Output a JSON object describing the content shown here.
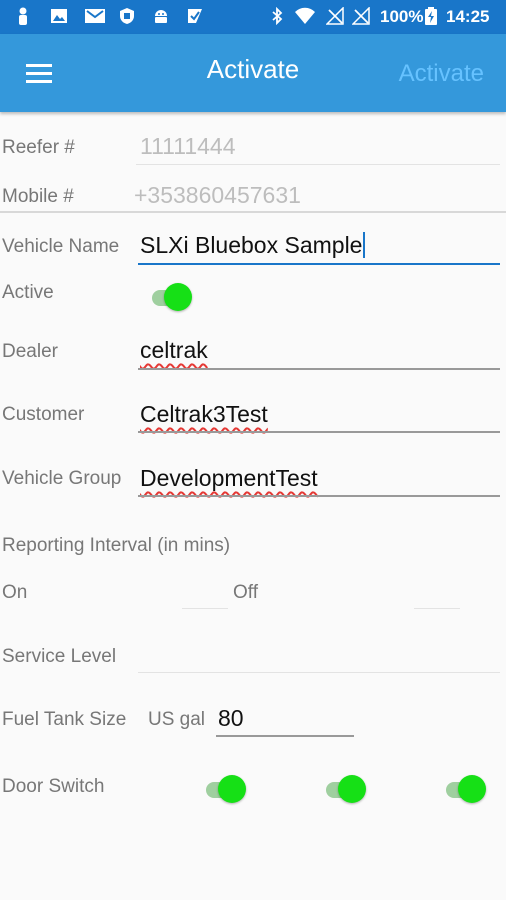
{
  "status_bar": {
    "battery_percent": "100%",
    "time": "14:25",
    "left_icons": [
      "person-icon",
      "image-icon",
      "gmail-icon",
      "shield-icon",
      "android-icon",
      "checkbox-icon"
    ],
    "right_icons": [
      "bluetooth-icon",
      "wifi-icon",
      "no-signal-icon",
      "no-signal-icon",
      "battery-icon"
    ]
  },
  "app_bar": {
    "title": "Activate",
    "action_label": "Activate",
    "menu_icon": "hamburger-menu-icon"
  },
  "form": {
    "reefer": {
      "label": "Reefer #",
      "value": "11111444"
    },
    "mobile": {
      "label": "Mobile #",
      "value": "+353860457631"
    },
    "vehicle_name": {
      "label": "Vehicle Name",
      "value": "SLXi Bluebox Sample"
    },
    "active": {
      "label": "Active",
      "on": true
    },
    "dealer": {
      "label": "Dealer",
      "value": "celtrak"
    },
    "customer": {
      "label": "Customer",
      "value": "Celtrak3Test"
    },
    "vehicle_group": {
      "label": "Vehicle Group",
      "value": "DevelopmentTest"
    },
    "reporting_interval": {
      "label": "Reporting Interval (in mins)",
      "on_label": "On",
      "off_label": "Off",
      "on_value": "",
      "off_value": ""
    },
    "service_level": {
      "label": "Service Level",
      "value": ""
    },
    "fuel_tank": {
      "label": "Fuel Tank Size",
      "unit": "US gal",
      "value": "80"
    },
    "door_switch": {
      "label": "Door Switch",
      "switches": [
        true,
        true,
        true
      ]
    }
  },
  "colors": {
    "status_bar": "#1976c9",
    "app_bar": "#3498db",
    "action_text": "#66c2ff",
    "toggle_on": "#16e016",
    "focused_underline": "#1976c9"
  }
}
